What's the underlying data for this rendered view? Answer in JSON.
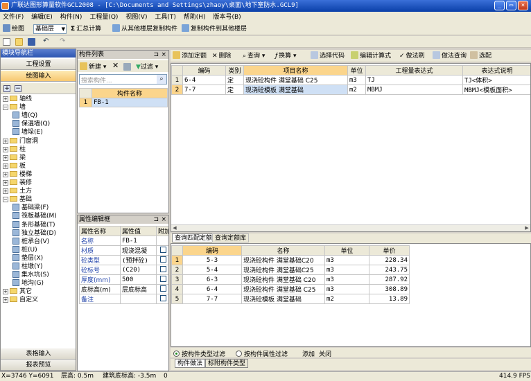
{
  "window": {
    "title": "广联达图形算量软件GCL2008 - [C:\\Documents and Settings\\zhaoy\\桌面\\地下室防水.GCL9]",
    "minimize": "_",
    "restore": "▭",
    "close": "×"
  },
  "menu": [
    "文件(F)",
    "编辑(E)",
    "构件(N)",
    "工程量(Q)",
    "视图(V)",
    "工具(T)",
    "帮助(H)",
    "版本号(B)"
  ],
  "toolbar1": {
    "draw": "绘图",
    "floor": "基础层",
    "sum": "汇总计算",
    "copy_from": "从其他楼层复制构件",
    "copy_to": "复制构件到其他楼层"
  },
  "nav": {
    "title": "模块导航栏",
    "project_settings": "工程设置",
    "draw_input": "绘图输入",
    "table_input": "表格输入",
    "report": "报表预览"
  },
  "tree": [
    {
      "label": "轴线",
      "level": 0,
      "type": "folder",
      "expanded": false
    },
    {
      "label": "墙",
      "level": 0,
      "type": "folder",
      "expanded": true
    },
    {
      "label": "墙(Q)",
      "level": 1,
      "type": "leaf"
    },
    {
      "label": "保温墙(Q)",
      "level": 1,
      "type": "leaf"
    },
    {
      "label": "墙垛(E)",
      "level": 1,
      "type": "leaf"
    },
    {
      "label": "门窗洞",
      "level": 0,
      "type": "folder",
      "expanded": false
    },
    {
      "label": "柱",
      "level": 0,
      "type": "folder",
      "expanded": false
    },
    {
      "label": "梁",
      "level": 0,
      "type": "folder",
      "expanded": false
    },
    {
      "label": "板",
      "level": 0,
      "type": "folder",
      "expanded": false
    },
    {
      "label": "楼梯",
      "level": 0,
      "type": "folder",
      "expanded": false
    },
    {
      "label": "装修",
      "level": 0,
      "type": "folder",
      "expanded": false
    },
    {
      "label": "土方",
      "level": 0,
      "type": "folder",
      "expanded": false
    },
    {
      "label": "基础",
      "level": 0,
      "type": "folder",
      "expanded": true
    },
    {
      "label": "基础梁(F)",
      "level": 1,
      "type": "leaf"
    },
    {
      "label": "筏板基础(M)",
      "level": 1,
      "type": "leaf"
    },
    {
      "label": "条形基础(T)",
      "level": 1,
      "type": "leaf"
    },
    {
      "label": "独立基础(D)",
      "level": 1,
      "type": "leaf"
    },
    {
      "label": "桩承台(V)",
      "level": 1,
      "type": "leaf"
    },
    {
      "label": "桩(U)",
      "level": 1,
      "type": "leaf"
    },
    {
      "label": "垫层(X)",
      "level": 1,
      "type": "leaf"
    },
    {
      "label": "柱墩(Y)",
      "level": 1,
      "type": "leaf"
    },
    {
      "label": "集水坑(S)",
      "level": 1,
      "type": "leaf"
    },
    {
      "label": "地沟(G)",
      "level": 1,
      "type": "leaf"
    },
    {
      "label": "其它",
      "level": 0,
      "type": "folder",
      "expanded": false
    },
    {
      "label": "自定义",
      "level": 0,
      "type": "folder",
      "expanded": false
    }
  ],
  "component_list": {
    "title": "构件列表",
    "new": "新建",
    "filter": "过滤",
    "search_placeholder": "搜索构件...",
    "column": "构件名称",
    "rows": [
      {
        "num": "1",
        "name": "FB-1"
      }
    ]
  },
  "properties": {
    "title": "属性编辑框",
    "headers": [
      "属性名称",
      "属性值",
      "附加"
    ],
    "rows": [
      {
        "name": "名称",
        "value": "FB-1",
        "blue": true,
        "check": false
      },
      {
        "name": "材质",
        "value": "现浇混凝",
        "blue": true,
        "check": true
      },
      {
        "name": "砼类型",
        "value": "(预拌砼)",
        "blue": true,
        "check": true
      },
      {
        "name": "砼标号",
        "value": "(C20)",
        "blue": true,
        "check": true
      },
      {
        "name": "厚度(mm)",
        "value": "500",
        "blue": true,
        "check": true
      },
      {
        "name": "底标高(m)",
        "value": "层底标高",
        "blue": false,
        "check": true
      },
      {
        "name": "备注",
        "value": "",
        "blue": true,
        "check": true
      }
    ]
  },
  "quota_toolbar": [
    "添加定额",
    "删除",
    "查询",
    "换算",
    "选择代码",
    "编辑计算式",
    "做法刷",
    "做法查询",
    "选配"
  ],
  "quota_table": {
    "headers": [
      "编码",
      "类别",
      "项目名称",
      "单位",
      "工程量表达式",
      "表达式说明"
    ],
    "rows": [
      {
        "num": "1",
        "code": "6-4",
        "cat": "定",
        "name": "现浇砼构件 满堂基础 C25",
        "unit": "m3",
        "expr": "TJ",
        "desc": "TJ<体积>"
      },
      {
        "num": "2",
        "code": "7-7",
        "cat": "定",
        "name": "现浇砼模板 满堂基础",
        "unit": "m2",
        "expr": "MBMJ",
        "desc": "MBMJ<模板面积>"
      }
    ]
  },
  "lib_tabs": [
    "查询匹配定额",
    "查询定额库"
  ],
  "lib_table": {
    "headers": [
      "编码",
      "名称",
      "单位",
      "单价"
    ],
    "rows": [
      {
        "num": "1",
        "code": "5-3",
        "name": "现浇砼构件 满堂基础C20",
        "unit": "m3",
        "price": "228.34"
      },
      {
        "num": "2",
        "code": "5-4",
        "name": "现浇砼构件 满堂基础C25",
        "unit": "m3",
        "price": "243.75"
      },
      {
        "num": "3",
        "code": "6-3",
        "name": "现浇砼构件 满堂基础 C20",
        "unit": "m3",
        "price": "287.92"
      },
      {
        "num": "4",
        "code": "6-4",
        "name": "现浇砼构件 满堂基础 C25",
        "unit": "m3",
        "price": "308.89"
      },
      {
        "num": "5",
        "code": "7-7",
        "name": "现浇砼模板 满堂基础",
        "unit": "m2",
        "price": "13.89"
      }
    ]
  },
  "filter_bar": {
    "by_type": "按构件类型过滤",
    "by_attr": "按构件属性过滤",
    "add": "添加",
    "close": "关闭"
  },
  "bottom_tabs": [
    "构件做法",
    "标附构件类型"
  ],
  "status": {
    "coords": "X=3746 Y=6091",
    "floor_height": "层高: 0.5m",
    "bottom": "建筑底标高: -3.5m",
    "zero": "0",
    "fps": "414.9 FPS"
  }
}
